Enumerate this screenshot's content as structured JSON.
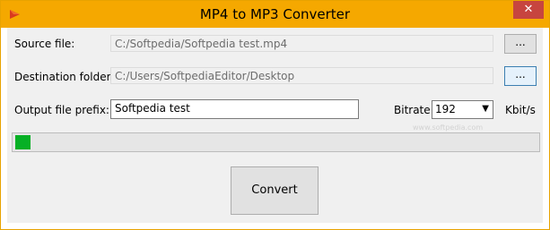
{
  "window": {
    "title": "MP4 to MP3 Converter",
    "close_label": "✕",
    "icon": "app-icon"
  },
  "source": {
    "label": "Source file:",
    "value": "C:/Softpedia/Softpedia test.mp4",
    "browse_label": "..."
  },
  "destination": {
    "label": "Destination folder:",
    "value": "C:/Users/SoftpediaEditor/Desktop",
    "browse_label": "..."
  },
  "prefix": {
    "label": "Output file prefix:",
    "value": "Softpedia test"
  },
  "bitrate": {
    "label": "Bitrate:",
    "value": "192",
    "unit": "Kbit/s"
  },
  "progress": {
    "fraction": 0.03,
    "color": "#06b025"
  },
  "actions": {
    "convert_label": "Convert"
  },
  "watermark": "www.softpedia.com"
}
